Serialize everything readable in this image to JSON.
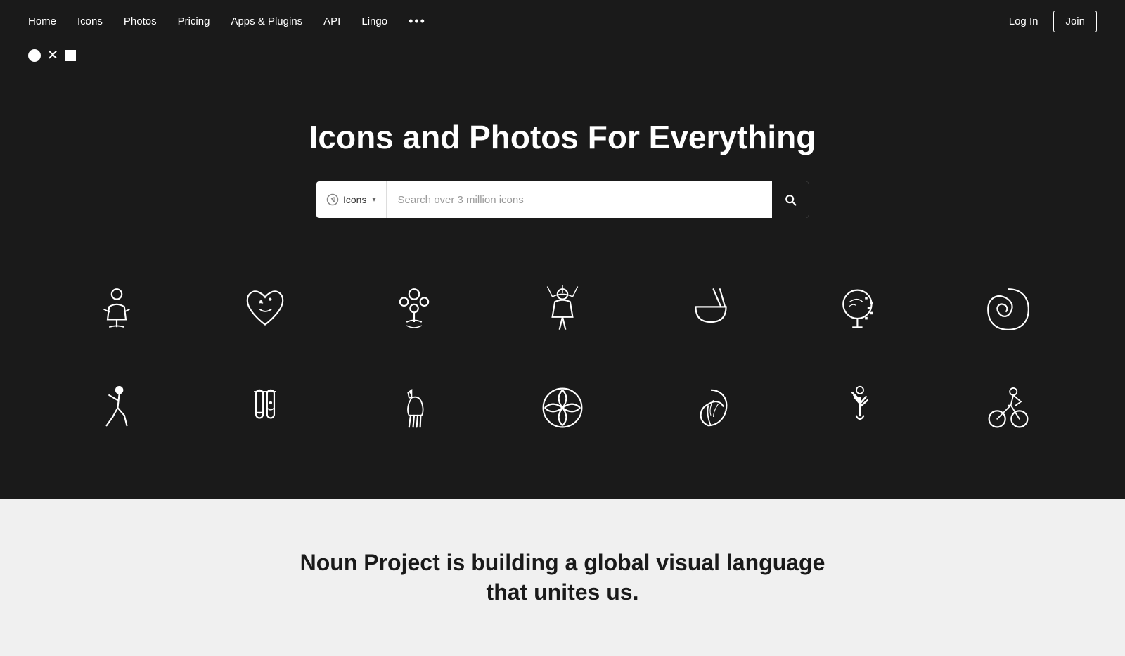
{
  "nav": {
    "links": [
      "Home",
      "Icons",
      "Photos",
      "Pricing",
      "Apps & Plugins",
      "API",
      "Lingo"
    ],
    "more_label": "•••",
    "login_label": "Log In",
    "join_label": "Join"
  },
  "hero": {
    "title": "Icons and Photos For Everything",
    "search": {
      "type_label": "Icons",
      "placeholder": "Search over 3 million icons"
    }
  },
  "bottom": {
    "title": "Noun Project is building a global visual language",
    "subtitle": "that unites us."
  }
}
